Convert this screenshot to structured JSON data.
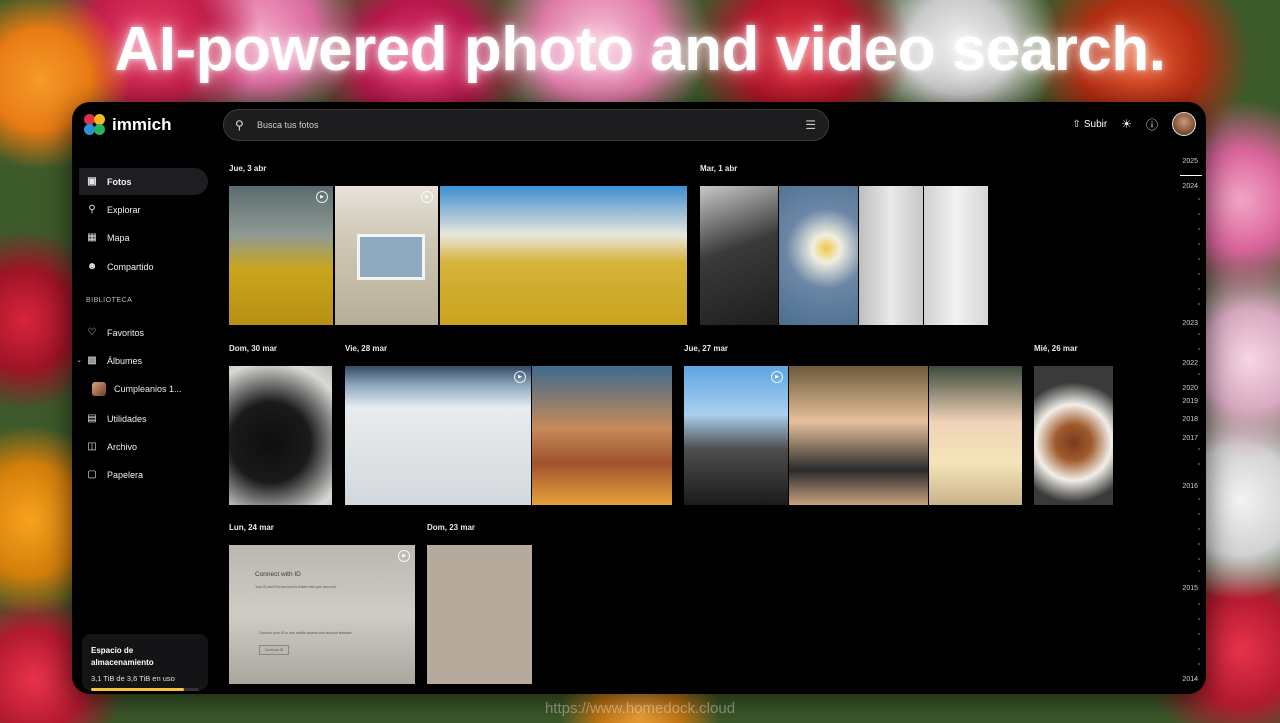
{
  "headline": "AI-powered photo and video search.",
  "watermark": "https://www.homedock.cloud",
  "app": {
    "name": "immich"
  },
  "search": {
    "placeholder": "Busca tus fotos"
  },
  "topbar": {
    "upload_label": "Subir"
  },
  "sidebar": {
    "items": [
      {
        "label": "Fotos",
        "icon": "photos-icon",
        "active": true
      },
      {
        "label": "Explorar",
        "icon": "search-icon"
      },
      {
        "label": "Mapa",
        "icon": "map-icon"
      },
      {
        "label": "Compartido",
        "icon": "people-icon"
      }
    ],
    "library_title": "BIBLIOTECA",
    "library": [
      {
        "label": "Favoritos",
        "icon": "heart-icon"
      },
      {
        "label": "Álbumes",
        "icon": "albums-icon"
      }
    ],
    "album_child": "Cumpleanios 1...",
    "library2": [
      {
        "label": "Utilidades",
        "icon": "toolbox-icon"
      },
      {
        "label": "Archivo",
        "icon": "archive-icon"
      },
      {
        "label": "Papelera",
        "icon": "trash-icon"
      }
    ],
    "storage": {
      "title": "Espacio de almacenamiento",
      "usage": "3,1 TiB de 3,6 TiB en uso",
      "fraction": 0.86
    }
  },
  "dates": [
    "Jue, 3 abr",
    "Mar, 1 abr",
    "Dom, 30 mar",
    "Vie, 28 mar",
    "Jue, 27 mar",
    "Mié, 26 mar",
    "Lun, 24 mar",
    "Dom, 23 mar"
  ],
  "timeline_years": [
    "2025",
    "2024",
    "2023",
    "2022",
    "2020",
    "2019",
    "2018",
    "2017",
    "2016",
    "2015",
    "2014"
  ],
  "photo_text": {
    "connect_title": "Connect with ID",
    "connect_line": "Your ID and Eno account is linked with your account.",
    "connect_line2": "Connect your ID to use mobile access and account features",
    "connect_btn": "Continue ID"
  },
  "colors": {
    "accent": "#f5c242",
    "bg": "#000000"
  }
}
